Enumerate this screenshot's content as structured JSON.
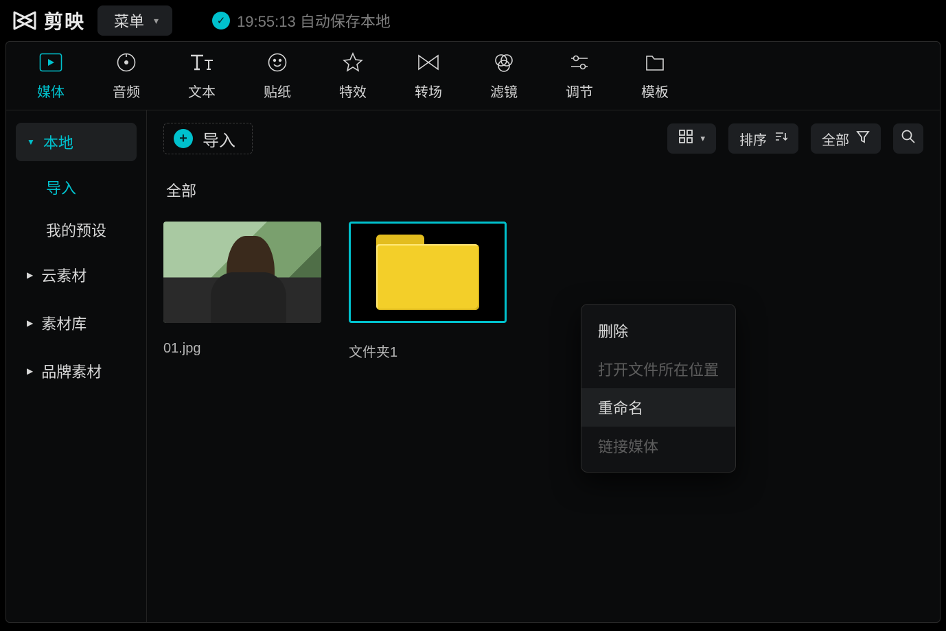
{
  "header": {
    "app_name": "剪映",
    "menu_label": "菜单",
    "save_time": "19:55:13",
    "save_text": "自动保存本地"
  },
  "tabs": {
    "media": "媒体",
    "audio": "音频",
    "text": "文本",
    "sticker": "贴纸",
    "effect": "特效",
    "transition": "转场",
    "filter": "滤镜",
    "adjust": "调节",
    "template": "模板"
  },
  "sidebar": {
    "local": "本地",
    "import": "导入",
    "my_presets": "我的预设",
    "cloud": "云素材",
    "library": "素材库",
    "brand": "品牌素材"
  },
  "main": {
    "import_label": "导入",
    "sort_label": "排序",
    "filter_label": "全部",
    "section_label": "全部",
    "items": [
      {
        "caption": "01.jpg"
      },
      {
        "caption": "文件夹1"
      }
    ]
  },
  "context_menu": {
    "delete": "删除",
    "open_location": "打开文件所在位置",
    "rename": "重命名",
    "link_media": "链接媒体"
  }
}
